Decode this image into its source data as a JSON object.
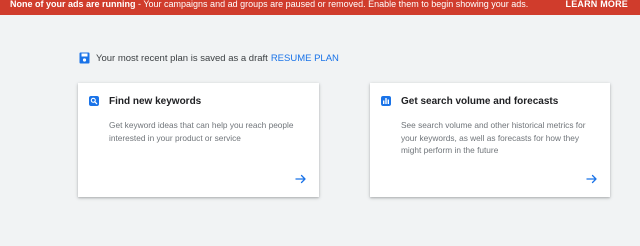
{
  "banner": {
    "strong": "None of your ads are running",
    "message": " - Your campaigns and ad groups are paused or removed. Enable them to begin showing your ads.",
    "button": "LEARN MORE"
  },
  "draft": {
    "text": "Your most recent plan is saved as a draft",
    "link": "RESUME PLAN"
  },
  "cards": [
    {
      "title": "Find new keywords",
      "description": "Get keyword ideas that can help you reach people interested in your product or service",
      "icon": "search-icon"
    },
    {
      "title": "Get search volume and forecasts",
      "description": "See search volume and other historical metrics for your keywords, as well as forecasts for how they might perform in the future",
      "icon": "bar-chart-icon"
    }
  ],
  "colors": {
    "banner": "#d03c2c",
    "accent": "#1a73e8",
    "background": "#f1f3f4"
  }
}
